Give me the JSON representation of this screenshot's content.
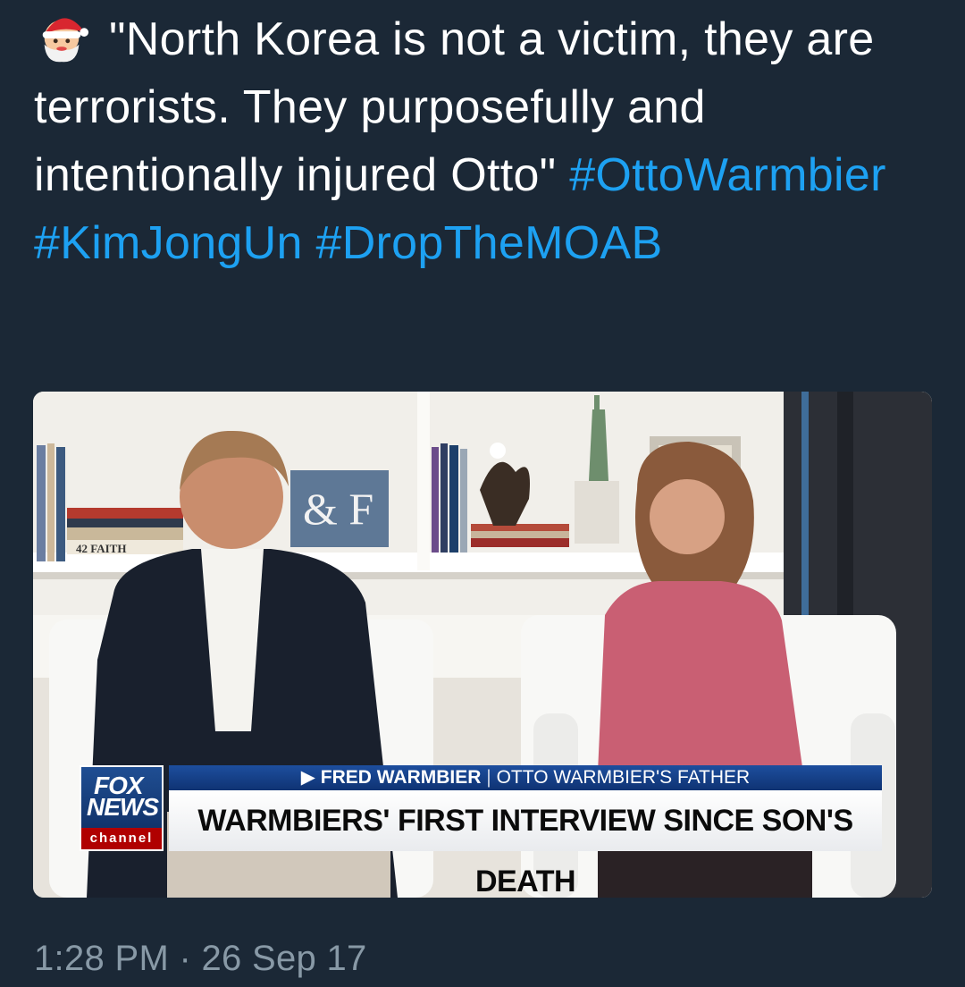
{
  "tweet": {
    "emoji": "santa-emoji",
    "text_prefix": "\"North Korea is not a victim, they are terrorists. They purposefully and intentionally injured Otto\"",
    "hashtags": [
      "#OttoWarmbier",
      "#KimJongUn",
      "#DropTheMOAB"
    ],
    "timestamp": "1:28 PM · 26 Sep 17"
  },
  "media": {
    "logo": {
      "line1": "FOX",
      "line2": "NEWS",
      "line3": "channel"
    },
    "strap_top": {
      "arrow": "▶",
      "name": "FRED WARMBIER",
      "separator": "|",
      "role": "OTTO WARMBIER'S FATHER"
    },
    "headline": "WARMBIERS' FIRST INTERVIEW SINCE SON'S DEATH",
    "set_props": {
      "sign": "& F",
      "book": "42 FAITH"
    }
  },
  "colors": {
    "background": "#1b2836",
    "hashtag": "#1da1f2",
    "timestamp": "#8899a6",
    "strap_blue": "#1d4e9e",
    "channel_red": "#b00000"
  }
}
